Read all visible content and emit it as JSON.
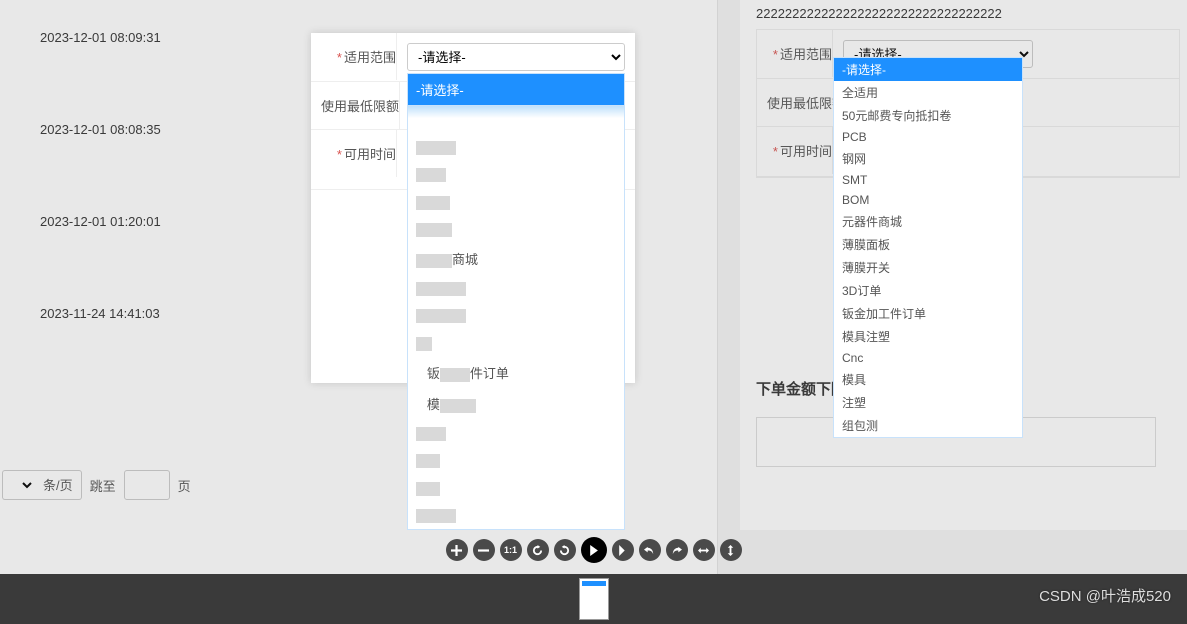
{
  "timestamps": [
    "2023-12-01 08:09:31",
    "2023-12-01 08:08:35",
    "2023-12-01 01:20:01",
    "2023-11-24 14:41:03"
  ],
  "pagination": {
    "per_page_suffix": "条/页",
    "jump_label": "跳至",
    "page_label": "页"
  },
  "form": {
    "row1_label": "适用范围",
    "row2_label": "使用最低限额",
    "row3_label": "可用时间",
    "select_placeholder": "-请选择-"
  },
  "left_dropdown": {
    "selected": "-请选择-",
    "partial_visible": [
      "商城",
      "件订单"
    ]
  },
  "right": {
    "long_text": "2222222222222222222222222222222222",
    "dropdown_options": [
      "-请选择-",
      "全适用",
      "50元邮费专向抵扣卷",
      "PCB",
      "钢网",
      "SMT",
      "BOM",
      "元器件商城",
      "薄膜面板",
      "薄膜开关",
      "3D订单",
      "钣金加工件订单",
      "模具注塑",
      "Cnc",
      "模具",
      "注塑",
      "组包测"
    ],
    "section_title": "下单金额下降"
  },
  "watermark": "CSDN @叶浩成520",
  "toolbar": {
    "icons": [
      "plus",
      "minus",
      "one-to-one",
      "rotate-cw",
      "rotate-ccw",
      "play",
      "next",
      "undo",
      "redo",
      "h-arrows",
      "v-arrows"
    ]
  }
}
